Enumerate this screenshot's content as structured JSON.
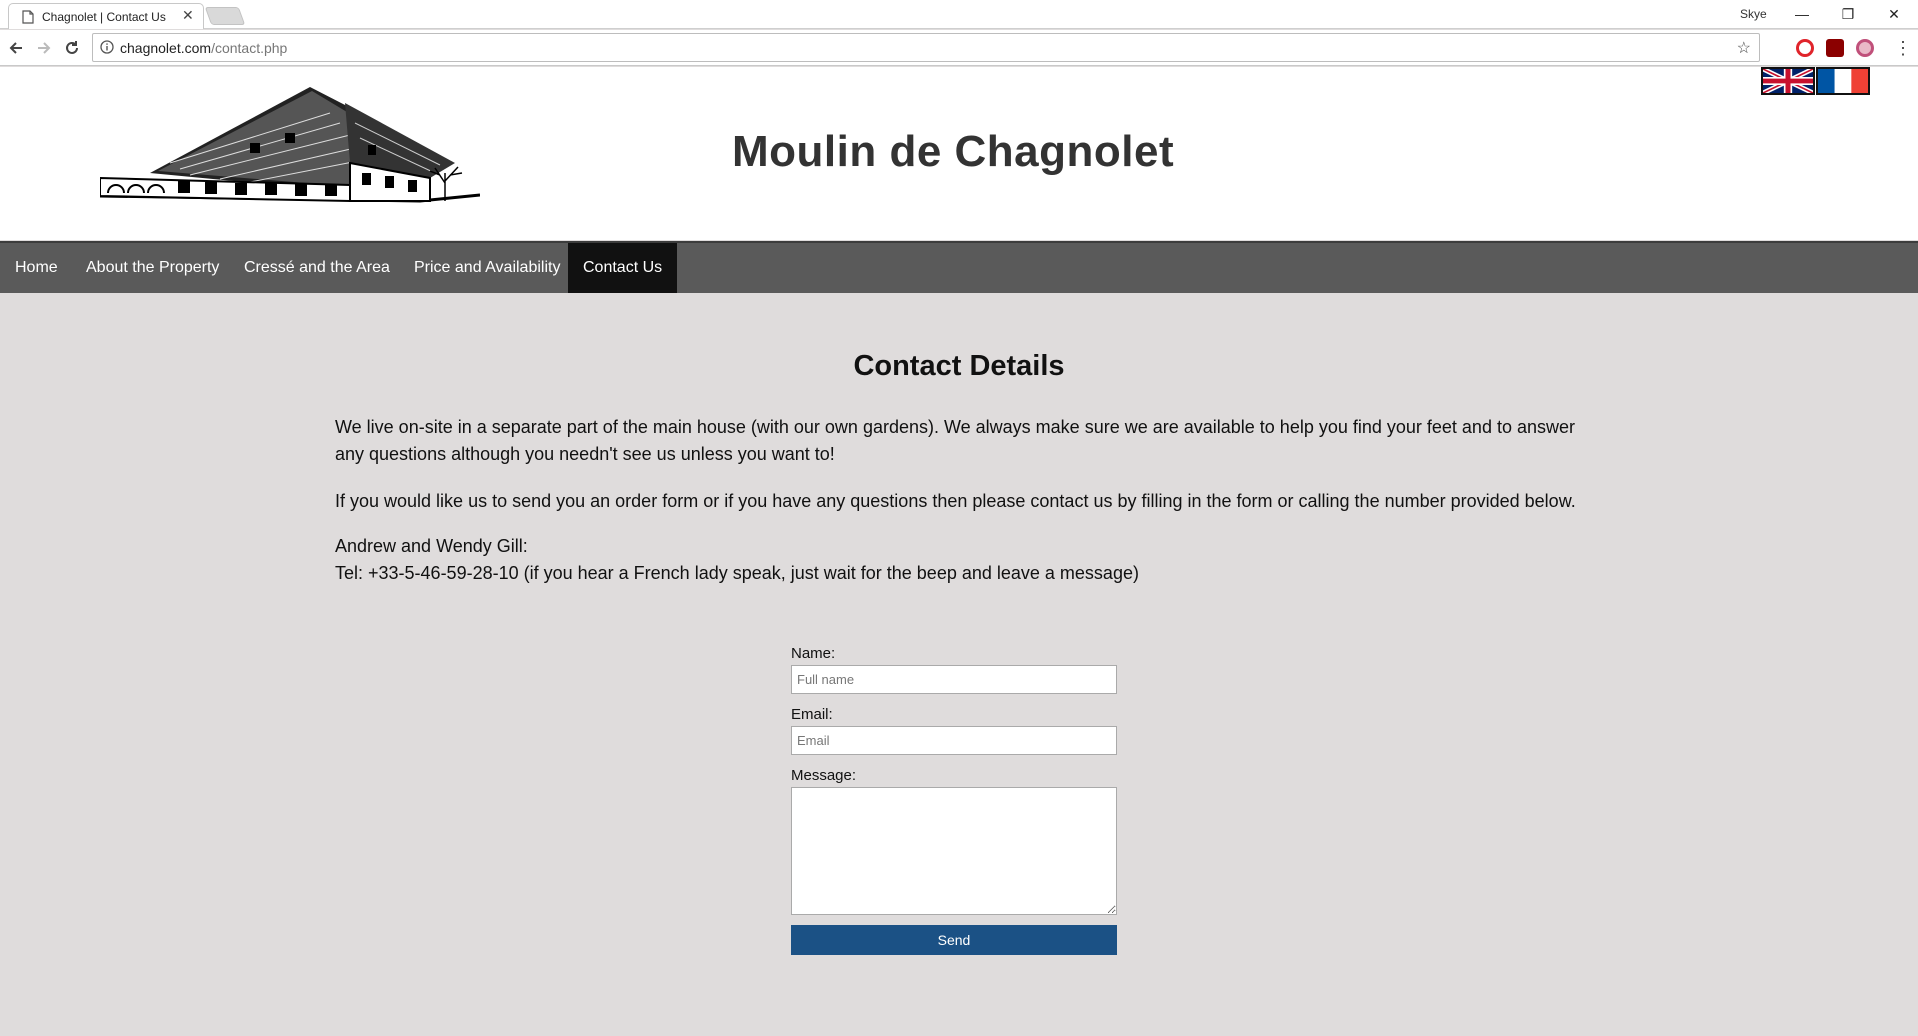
{
  "browser": {
    "tab_title": "Chagnolet | Contact Us",
    "tab_close": "✕",
    "user_name": "Skye",
    "url_host": "chagnolet.com",
    "url_path": "/contact.php",
    "window_controls": {
      "minimize": "—",
      "restore": "❐",
      "close": "✕"
    },
    "bookmark_star": "☆",
    "menu": "⋮"
  },
  "site": {
    "title": "Moulin de Chagnolet",
    "logo_icon": "mill-house-drawing-icon",
    "languages": [
      "English",
      "Français"
    ]
  },
  "nav": {
    "items": [
      {
        "label": "Home",
        "active": false
      },
      {
        "label": "About the Property",
        "active": false
      },
      {
        "label": "Cressé and the Area",
        "active": false
      },
      {
        "label": "Price and Availability",
        "active": false
      },
      {
        "label": "Contact Us",
        "active": true
      }
    ]
  },
  "content": {
    "heading": "Contact Details",
    "paragraph1": "We live on-site in a separate part of the main house (with our own gardens). We always make sure we are available to help you find your feet and to answer any questions although you needn't see us unless you want to!",
    "paragraph2": "If you would like us to send you an order form or if you have any questions then please contact us by filling in the form or calling the number provided below.",
    "names": "Andrew and Wendy Gill:",
    "tel": "Tel: +33-5-46-59-28-10 (if you hear a French lady speak, just wait for the beep and leave a message)"
  },
  "form": {
    "name_label": "Name:",
    "name_placeholder": "Full name",
    "email_label": "Email:",
    "email_placeholder": "Email",
    "message_label": "Message:",
    "send_label": "Send"
  },
  "colors": {
    "page_bg": "#dfdcdc",
    "nav_bg": "#5a5a5a",
    "nav_active": "#111111",
    "send_button": "#1b5185"
  }
}
